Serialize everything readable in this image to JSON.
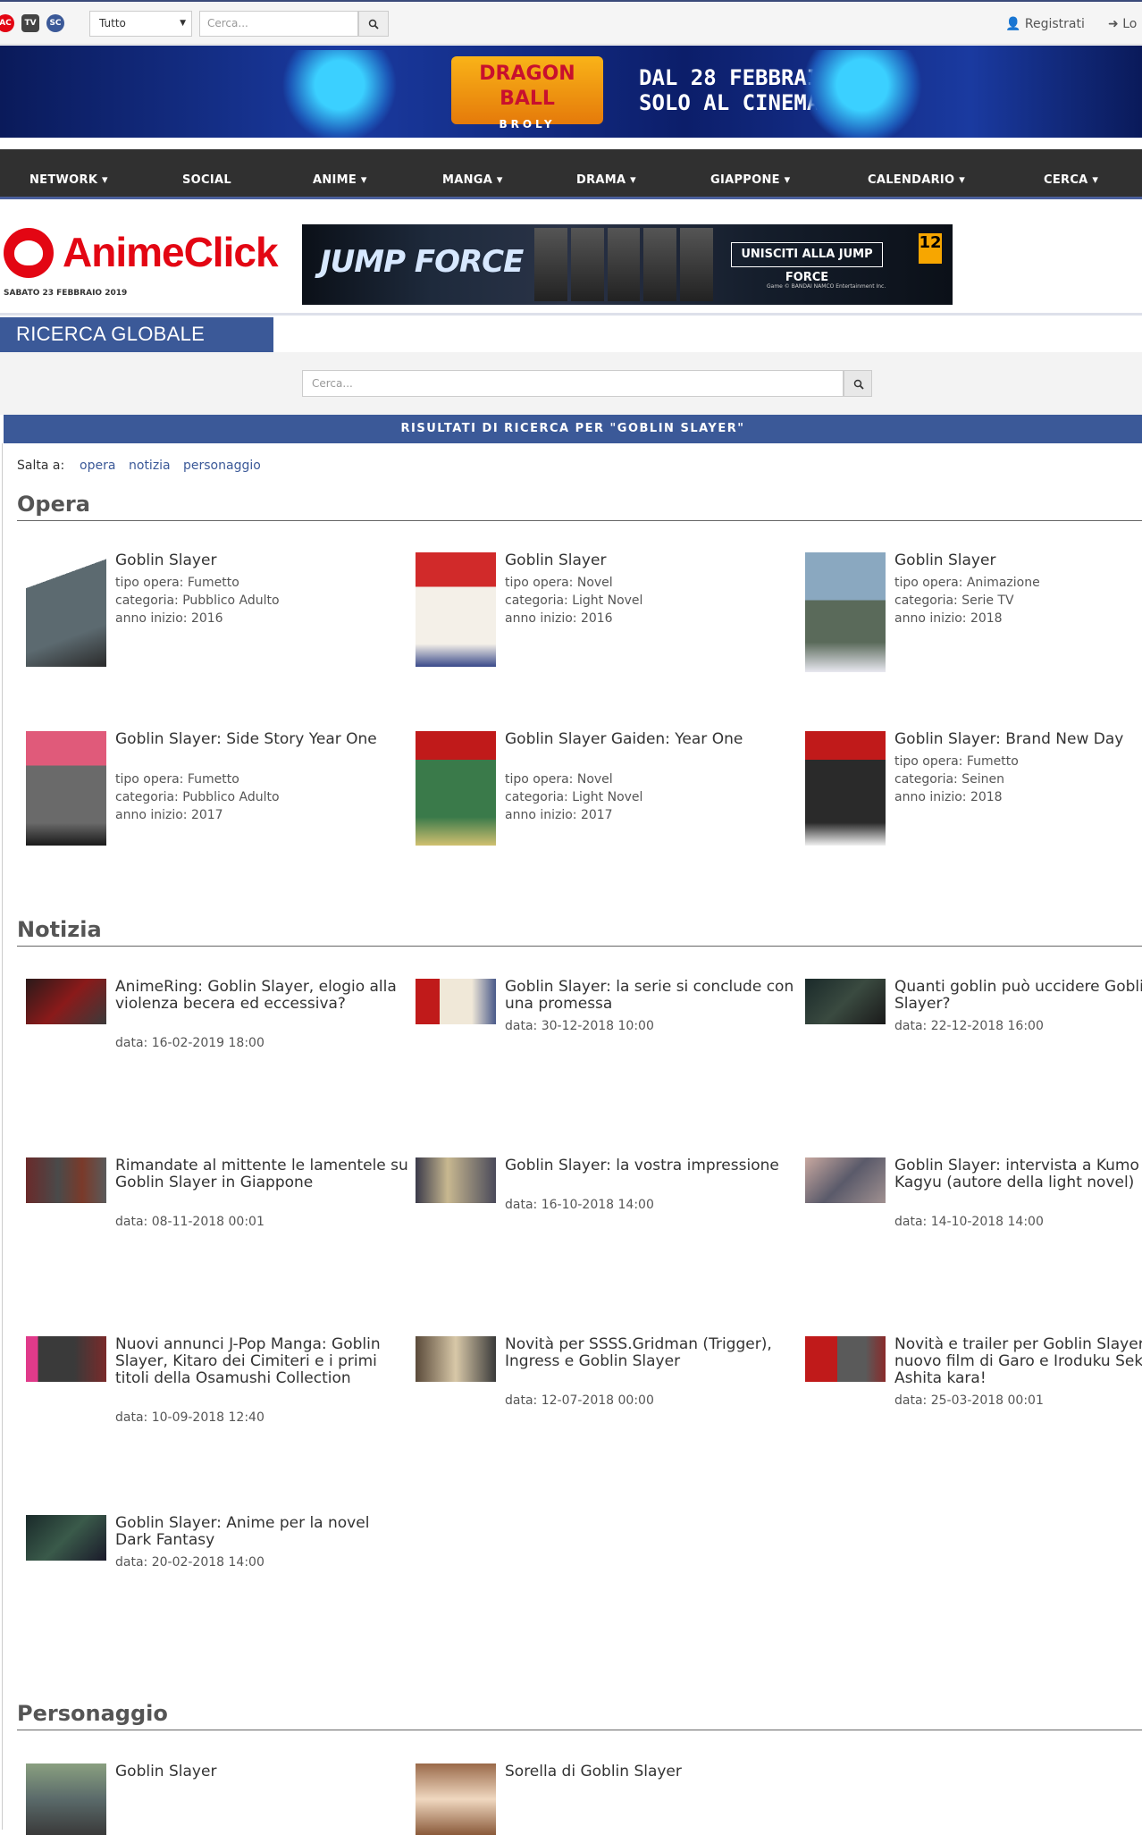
{
  "topbar": {
    "sites": [
      "AC",
      "TV",
      "SC"
    ],
    "select_value": "Tutto",
    "search_placeholder": "Cerca...",
    "registrati": "Registrati",
    "login": "Lo"
  },
  "banner_top": {
    "logo_line1": "DRAGON BALL",
    "logo_line2": "BROLY",
    "text_line1": "DAL 28 FEBBRAIO",
    "text_line2": "SOLO AL CINEMA"
  },
  "nav": {
    "items": [
      "NETWORK ▾",
      "SOCIAL",
      "ANIME ▾",
      "MANGA ▾",
      "DRAMA ▾",
      "GIAPPONE ▾",
      "CALENDARIO ▾",
      "CERCA ▾"
    ]
  },
  "logo": {
    "text": "AnimeClick",
    "date": "SABATO 23 FEBBRAIO 2019"
  },
  "banner_ad": {
    "title": "JUMP FORCE",
    "cta": "UNISCITI ALLA JUMP FORCE",
    "rating": "12",
    "small": "Game © BANDAI NAMCO Entertainment Inc."
  },
  "page": {
    "title": "RICERCA GLOBALE",
    "search_placeholder": "Cerca...",
    "results_header": "RISULTATI DI RICERCA PER \"GOBLIN SLAYER\"",
    "salta_label": "Salta a:",
    "salta_links": [
      "opera",
      "notizia",
      "personaggio"
    ]
  },
  "sections": {
    "opera": "Opera",
    "notizia": "Notizia",
    "personaggio": "Personaggio"
  },
  "opere": [
    {
      "title": "Goblin Slayer",
      "tipo": "tipo opera: Fumetto",
      "categoria": "categoria: Pubblico Adulto",
      "anno": "anno inizio: 2016"
    },
    {
      "title": "Goblin Slayer",
      "tipo": "tipo opera: Novel",
      "categoria": "categoria: Light Novel",
      "anno": "anno inizio: 2016"
    },
    {
      "title": "Goblin Slayer",
      "tipo": "tipo opera: Animazione",
      "categoria": "categoria: Serie TV",
      "anno": "anno inizio: 2018"
    },
    {
      "title": "Goblin Slayer: Side Story Year One",
      "tipo": "tipo opera: Fumetto",
      "categoria": "categoria: Pubblico Adulto",
      "anno": "anno inizio: 2017"
    },
    {
      "title": "Goblin Slayer Gaiden: Year One",
      "tipo": "tipo opera: Novel",
      "categoria": "categoria: Light Novel",
      "anno": "anno inizio: 2017"
    },
    {
      "title": "Goblin Slayer: Brand New Day",
      "tipo": "tipo opera: Fumetto",
      "categoria": "categoria: Seinen",
      "anno": "anno inizio: 2018"
    }
  ],
  "notizie": [
    {
      "title": "AnimeRing: Goblin Slayer, elogio alla violenza becera ed eccessiva?",
      "data": "data: 16-02-2019 18:00"
    },
    {
      "title": "Goblin Slayer: la serie si conclude con una promessa",
      "data": "data: 30-12-2018 10:00"
    },
    {
      "title": "Quanti goblin può uccidere Goblin Slayer?",
      "data": "data: 22-12-2018 16:00"
    },
    {
      "title": "Rimandate al mittente le lamentele su Goblin Slayer in Giappone",
      "data": "data: 08-11-2018 00:01"
    },
    {
      "title": "Goblin Slayer: la vostra impressione",
      "data": "data: 16-10-2018 14:00"
    },
    {
      "title": "Goblin Slayer: intervista a Kumo Kagyu (autore della light novel)",
      "data": "data: 14-10-2018 14:00"
    },
    {
      "title": "Nuovi annunci J-Pop Manga: Goblin Slayer, Kitaro dei Cimiteri e i primi titoli della Osamushi Collection",
      "data": "data: 10-09-2018 12:40"
    },
    {
      "title": "Novità per SSSS.Gridman (Trigger), Ingress e Goblin Slayer",
      "data": "data: 12-07-2018 00:00"
    },
    {
      "title": "Novità e trailer per Goblin Slayer, il nuovo film di Garo e Iroduku Sekai no Ashita kara!",
      "data": "data: 25-03-2018 00:01"
    },
    {
      "title": "Goblin Slayer: Anime per la novel Dark Fantasy",
      "data": "data: 20-02-2018 14:00"
    }
  ],
  "personaggi": [
    {
      "title": "Goblin Slayer"
    },
    {
      "title": "Sorella di Goblin Slayer"
    }
  ],
  "colors": {
    "brand_blue": "#3b5998",
    "brand_red": "#e30613",
    "nav_bg": "#303030"
  }
}
